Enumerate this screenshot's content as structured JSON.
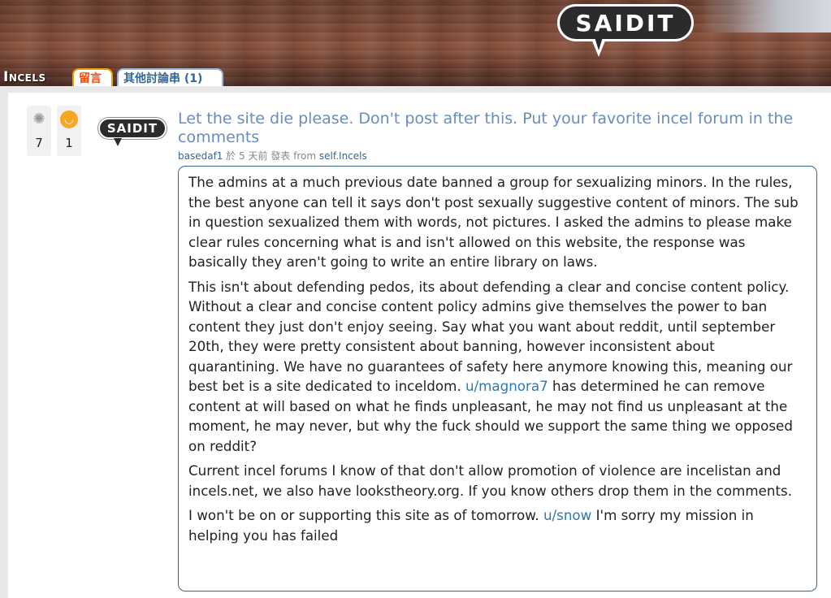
{
  "header": {
    "logo_text": "SAIDIT",
    "subreddit_name": "Incels",
    "tabs": [
      {
        "label": "留言",
        "active": true
      },
      {
        "label": "其他討論串 (1)",
        "active": false
      }
    ]
  },
  "post": {
    "votes": [
      {
        "icon": "bulb-icon",
        "count": "7"
      },
      {
        "icon": "laugh-icon",
        "count": "1"
      }
    ],
    "thumbnail_text": "SAIDIT",
    "title": "Let the site die please. Don't post after this. Put your favorite incel forum in the comments",
    "author": "basedaf1",
    "posted_text": " 於 5 天前 發表 ",
    "from_label": "from",
    "source": "self.Incels",
    "body": {
      "p1": "The admins at a much previous date banned a group for sexualizing minors. In the rules, the best anyone can tell it says don't post sexually suggestive content of minors. The sub in question sexualized them with words, not pictures. I asked the admins to please make clear rules concerning what is and isn't allowed on this website, the response was basically they aren't going to write an entire library on laws.",
      "p2_before": "This isn't about defending pedos, its about defending a clear and concise content policy. Without a clear and concise content policy admins give themselves the power to ban content they just don't enjoy seeing. Say what you want about reddit, until september 20th, they were pretty consistent about banning, however inconsistent about quarantining. We have no guarantees of safety here anymore knowing this, meaning our best bet is a site dedicated to inceldom. ",
      "p2_link": "u/magnora7",
      "p2_after": " has determined he can remove content at will based on what he finds unpleasant, he may not find us unpleasant at the moment, he may never, but why the fuck should we support the same thing we opposed on reddit?",
      "p3": "Current incel forums I know of that don't allow promotion of violence are incelistan and incels.net, we also have lookstheory.org. If you know others drop them in the comments.",
      "p4_before": "I won't be on or supporting this site as of tomorrow. ",
      "p4_link": "u/snow",
      "p4_after": " I'm sorry my mission in helping you has failed"
    }
  }
}
